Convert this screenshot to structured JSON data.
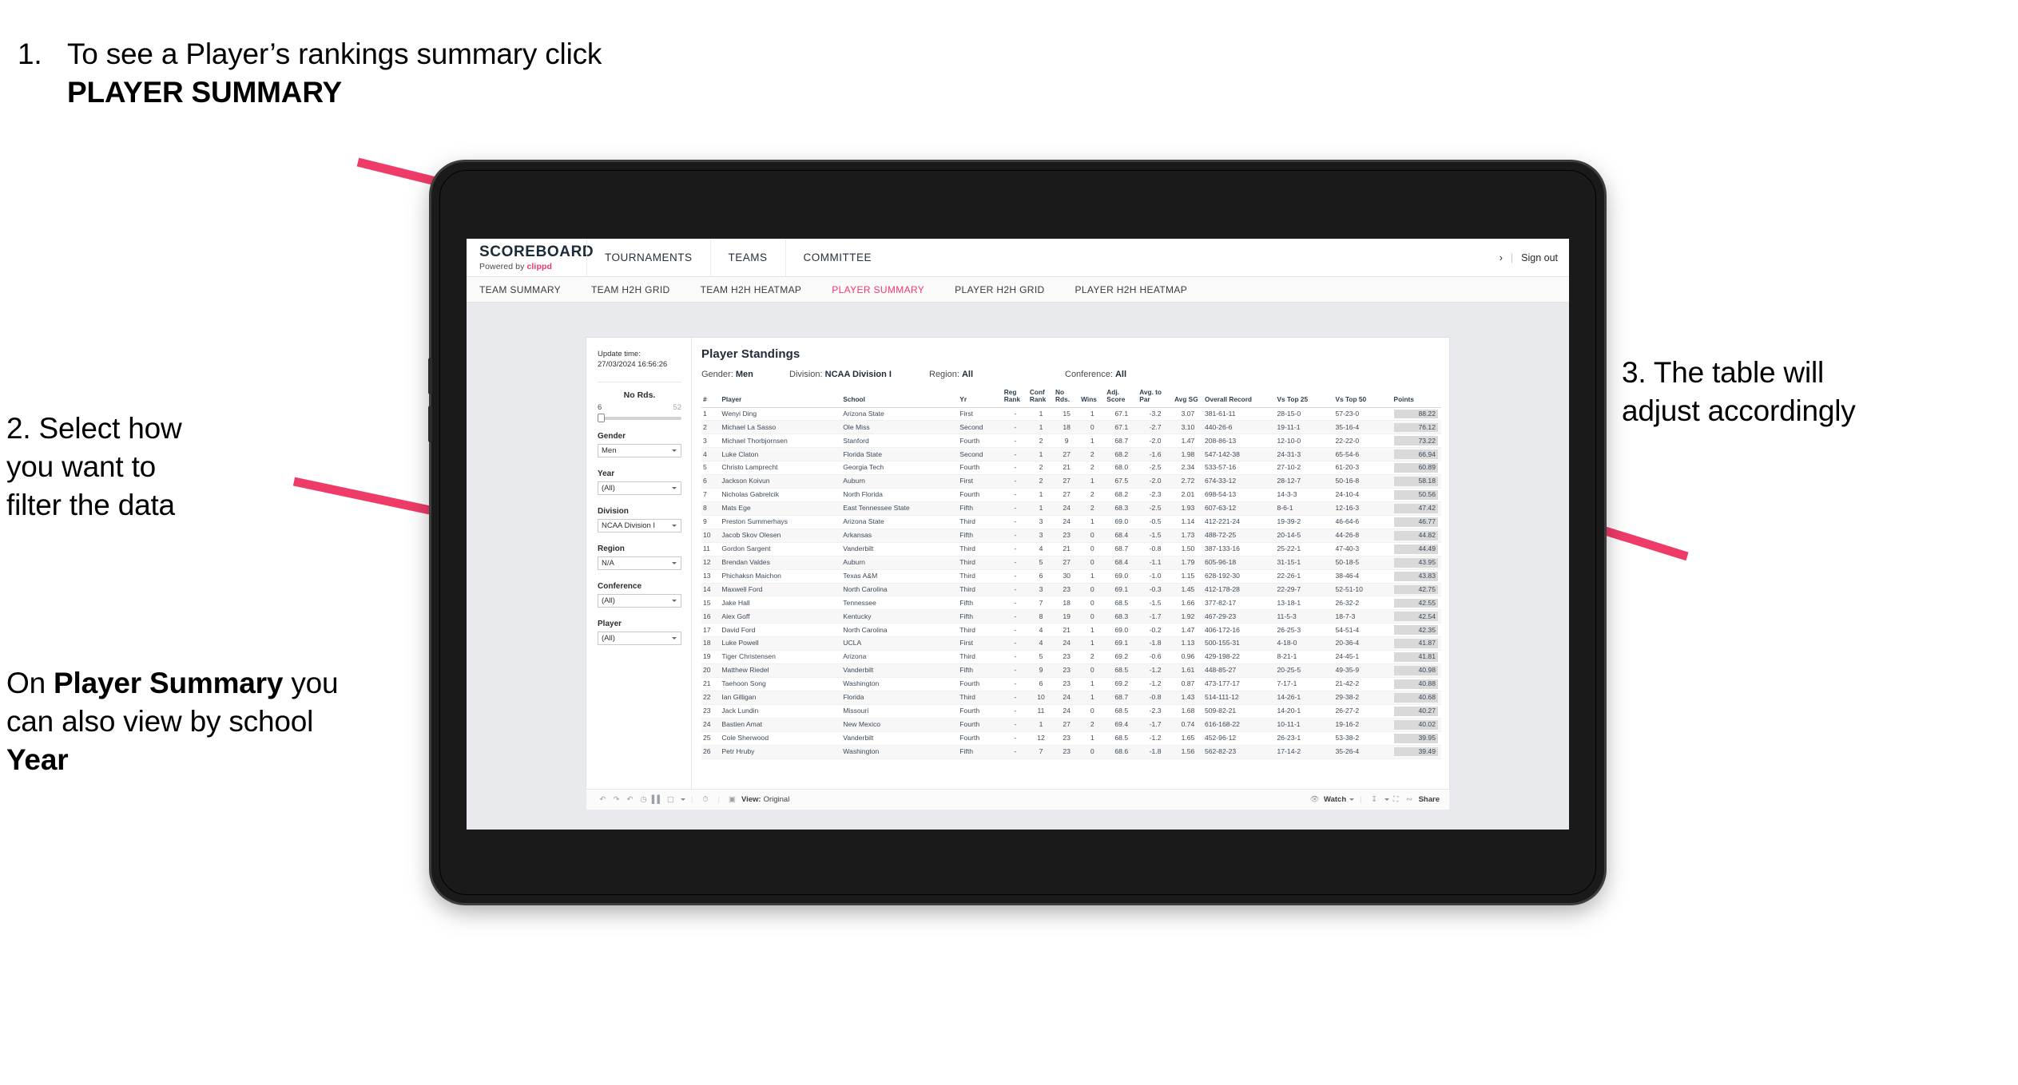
{
  "annotations": {
    "a1_num": "1.",
    "a1_text_pre": "To see a Player’s rankings summary click ",
    "a1_bold": "PLAYER SUMMARY",
    "a2_line1": "2. Select how",
    "a2_line2": "you want to",
    "a2_line3": "filter the data",
    "a2b_pre": "On ",
    "a2b_bold1": "Player Summary",
    "a2b_mid": " you can also view by school ",
    "a2b_bold2": "Year",
    "a3_line1": "3. The table will",
    "a3_line2": "adjust accordingly"
  },
  "app": {
    "brand_name": "SCOREBOARD",
    "brand_sub_pre": "Powered by ",
    "brand_sub_clippd": "clippd",
    "top_nav": [
      "TOURNAMENTS",
      "TEAMS",
      "COMMITTEE"
    ],
    "account_glyph": "›",
    "sep": "|",
    "sign_out": "Sign out",
    "sub_nav": [
      {
        "label": "TEAM SUMMARY",
        "active": false
      },
      {
        "label": "TEAM H2H GRID",
        "active": false
      },
      {
        "label": "TEAM H2H HEATMAP",
        "active": false
      },
      {
        "label": "PLAYER SUMMARY",
        "active": true
      },
      {
        "label": "PLAYER H2H GRID",
        "active": false
      },
      {
        "label": "PLAYER H2H HEATMAP",
        "active": false
      }
    ],
    "accent_color": "#f4376d"
  },
  "rail": {
    "update_label": "Update time:",
    "update_value": "27/03/2024 16:56:26",
    "slider": {
      "title": "No Rds.",
      "min": "6",
      "max": "52"
    },
    "filters": [
      {
        "label": "Gender",
        "value": "Men"
      },
      {
        "label": "Year",
        "value": "(All)"
      },
      {
        "label": "Division",
        "value": "NCAA Division I"
      },
      {
        "label": "Region",
        "value": "N/A"
      },
      {
        "label": "Conference",
        "value": "(All)"
      },
      {
        "label": "Player",
        "value": "(All)"
      }
    ]
  },
  "viz": {
    "title": "Player Standings",
    "crumbs": [
      {
        "label": "Gender: ",
        "value": "Men"
      },
      {
        "label": "Division: ",
        "value": "NCAA Division I"
      },
      {
        "label": "Region: ",
        "value": "All"
      },
      {
        "label": "Conference: ",
        "value": "All"
      }
    ],
    "columns": [
      "#",
      "Player",
      "School",
      "Yr",
      "Reg Rank",
      "Conf Rank",
      "No Rds.",
      "Wins",
      "Adj. Score",
      "Avg. to Par",
      "Avg SG",
      "Overall Record",
      "Vs Top 25",
      "Vs Top 50",
      "Points"
    ],
    "rows": [
      [
        "1",
        "Wenyi Ding",
        "Arizona State",
        "First",
        "-",
        "1",
        "15",
        "1",
        "67.1",
        "-3.2",
        "3.07",
        "381-61-11",
        "28-15-0",
        "57-23-0",
        "88.22"
      ],
      [
        "2",
        "Michael La Sasso",
        "Ole Miss",
        "Second",
        "-",
        "1",
        "18",
        "0",
        "67.1",
        "-2.7",
        "3.10",
        "440-26-6",
        "19-11-1",
        "35-16-4",
        "76.12"
      ],
      [
        "3",
        "Michael Thorbjornsen",
        "Stanford",
        "Fourth",
        "-",
        "2",
        "9",
        "1",
        "68.7",
        "-2.0",
        "1.47",
        "208-86-13",
        "12-10-0",
        "22-22-0",
        "73.22"
      ],
      [
        "4",
        "Luke Claton",
        "Florida State",
        "Second",
        "-",
        "1",
        "27",
        "2",
        "68.2",
        "-1.6",
        "1.98",
        "547-142-38",
        "24-31-3",
        "65-54-6",
        "66.94"
      ],
      [
        "5",
        "Christo Lamprecht",
        "Georgia Tech",
        "Fourth",
        "-",
        "2",
        "21",
        "2",
        "68.0",
        "-2.5",
        "2.34",
        "533-57-16",
        "27-10-2",
        "61-20-3",
        "60.89"
      ],
      [
        "6",
        "Jackson Koivun",
        "Auburn",
        "First",
        "-",
        "2",
        "27",
        "1",
        "67.5",
        "-2.0",
        "2.72",
        "674-33-12",
        "28-12-7",
        "50-16-8",
        "58.18"
      ],
      [
        "7",
        "Nicholas Gabrelcik",
        "North Florida",
        "Fourth",
        "-",
        "1",
        "27",
        "2",
        "68.2",
        "-2.3",
        "2.01",
        "698-54-13",
        "14-3-3",
        "24-10-4",
        "50.56"
      ],
      [
        "8",
        "Mats Ege",
        "East Tennessee State",
        "Fifth",
        "-",
        "1",
        "24",
        "2",
        "68.3",
        "-2.5",
        "1.93",
        "607-63-12",
        "8-6-1",
        "12-16-3",
        "47.42"
      ],
      [
        "9",
        "Preston Summerhays",
        "Arizona State",
        "Third",
        "-",
        "3",
        "24",
        "1",
        "69.0",
        "-0.5",
        "1.14",
        "412-221-24",
        "19-39-2",
        "46-64-6",
        "46.77"
      ],
      [
        "10",
        "Jacob Skov Olesen",
        "Arkansas",
        "Fifth",
        "-",
        "3",
        "23",
        "0",
        "68.4",
        "-1.5",
        "1.73",
        "488-72-25",
        "20-14-5",
        "44-26-8",
        "44.82"
      ],
      [
        "11",
        "Gordon Sargent",
        "Vanderbilt",
        "Third",
        "-",
        "4",
        "21",
        "0",
        "68.7",
        "-0.8",
        "1.50",
        "387-133-16",
        "25-22-1",
        "47-40-3",
        "44.49"
      ],
      [
        "12",
        "Brendan Valdes",
        "Auburn",
        "Third",
        "-",
        "5",
        "27",
        "0",
        "68.4",
        "-1.1",
        "1.79",
        "605-96-18",
        "31-15-1",
        "50-18-5",
        "43.95"
      ],
      [
        "13",
        "Phichaksn Maichon",
        "Texas A&M",
        "Third",
        "-",
        "6",
        "30",
        "1",
        "69.0",
        "-1.0",
        "1.15",
        "628-192-30",
        "22-26-1",
        "38-46-4",
        "43.83"
      ],
      [
        "14",
        "Maxwell Ford",
        "North Carolina",
        "Third",
        "-",
        "3",
        "23",
        "0",
        "69.1",
        "-0.3",
        "1.45",
        "412-178-28",
        "22-29-7",
        "52-51-10",
        "42.75"
      ],
      [
        "15",
        "Jake Hall",
        "Tennessee",
        "Fifth",
        "-",
        "7",
        "18",
        "0",
        "68.5",
        "-1.5",
        "1.66",
        "377-82-17",
        "13-18-1",
        "26-32-2",
        "42.55"
      ],
      [
        "16",
        "Alex Goff",
        "Kentucky",
        "Fifth",
        "-",
        "8",
        "19",
        "0",
        "68.3",
        "-1.7",
        "1.92",
        "467-29-23",
        "11-5-3",
        "18-7-3",
        "42.54"
      ],
      [
        "17",
        "David Ford",
        "North Carolina",
        "Third",
        "-",
        "4",
        "21",
        "1",
        "69.0",
        "-0.2",
        "1.47",
        "406-172-16",
        "26-25-3",
        "54-51-4",
        "42.35"
      ],
      [
        "18",
        "Luke Powell",
        "UCLA",
        "First",
        "-",
        "4",
        "24",
        "1",
        "69.1",
        "-1.8",
        "1.13",
        "500-155-31",
        "4-18-0",
        "20-36-4",
        "41.87"
      ],
      [
        "19",
        "Tiger Christensen",
        "Arizona",
        "Third",
        "-",
        "5",
        "23",
        "2",
        "69.2",
        "-0.6",
        "0.96",
        "429-198-22",
        "8-21-1",
        "24-45-1",
        "41.81"
      ],
      [
        "20",
        "Matthew Riedel",
        "Vanderbilt",
        "Fifth",
        "-",
        "9",
        "23",
        "0",
        "68.5",
        "-1.2",
        "1.61",
        "448-85-27",
        "20-25-5",
        "49-35-9",
        "40.98"
      ],
      [
        "21",
        "Taehoon Song",
        "Washington",
        "Fourth",
        "-",
        "6",
        "23",
        "1",
        "69.2",
        "-1.2",
        "0.87",
        "473-177-17",
        "7-17-1",
        "21-42-2",
        "40.88"
      ],
      [
        "22",
        "Ian Gilligan",
        "Florida",
        "Third",
        "-",
        "10",
        "24",
        "1",
        "68.7",
        "-0.8",
        "1.43",
        "514-111-12",
        "14-26-1",
        "29-38-2",
        "40.68"
      ],
      [
        "23",
        "Jack Lundin",
        "Missouri",
        "Fourth",
        "-",
        "11",
        "24",
        "0",
        "68.5",
        "-2.3",
        "1.68",
        "509-82-21",
        "14-20-1",
        "26-27-2",
        "40.27"
      ],
      [
        "24",
        "Bastien Amat",
        "New Mexico",
        "Fourth",
        "-",
        "1",
        "27",
        "2",
        "69.4",
        "-1.7",
        "0.74",
        "616-168-22",
        "10-11-1",
        "19-16-2",
        "40.02"
      ],
      [
        "25",
        "Cole Sherwood",
        "Vanderbilt",
        "Fourth",
        "-",
        "12",
        "23",
        "1",
        "68.5",
        "-1.2",
        "1.65",
        "452-96-12",
        "26-23-1",
        "53-38-2",
        "39.95"
      ],
      [
        "26",
        "Petr Hruby",
        "Washington",
        "Fifth",
        "-",
        "7",
        "23",
        "0",
        "68.6",
        "-1.8",
        "1.56",
        "562-82-23",
        "17-14-2",
        "35-26-4",
        "39.49"
      ]
    ]
  },
  "vizbar": {
    "view_label": "View: ",
    "view_value": "Original",
    "watch": "Watch",
    "share": "Share"
  }
}
